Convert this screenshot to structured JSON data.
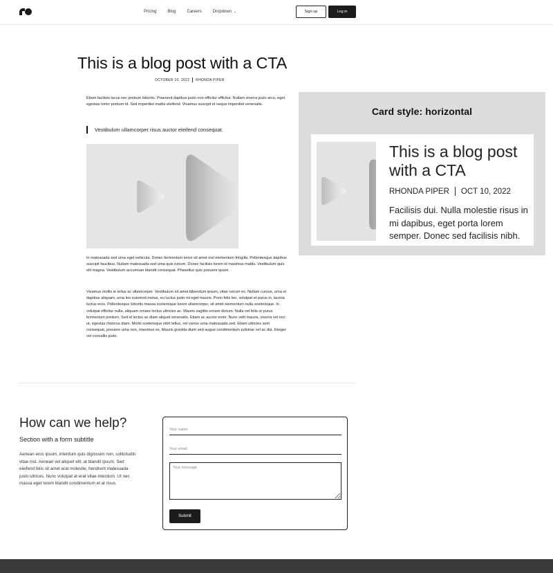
{
  "nav": {
    "links": [
      "Pricing",
      "Blog",
      "Careers",
      "Dropdown"
    ],
    "signup_label": "Sign up",
    "login_label": "Log in"
  },
  "post": {
    "title": "This is a blog post with a CTA",
    "date": "OCTOBER 10, 2022",
    "author": "RHONDA PIPER",
    "paragraph1": "Etiam facilisis lacus nec pretium lobortis. Praesent dapibus justo non efficitur efficitur. Nullam viverra justo arcu, eget egestas tortor pretium id. Sed imperdiet mattis eleifend. Vivamus suscipit et neque imperdiet venenatis.",
    "quote": "Vestibulum ullamcorper risus auctor eleifend consequat.",
    "paragraph2": "In malesuada sed urna eget vehicula. Donec fermentum tortor sit amet nisl elementum fringilla. Pellentesque dapibus suscipit faucibus. Nullam malesuada sed urna quis rutrum. Donec facilisis lorem id maximus mattis. Vestibulum quis elit magna. Vestibulum accumsan blandit consequat. Phasellus quis posuere quam.",
    "paragraph3": "Vivamus mollis in tellus ac ullamcorper. Vestibulum sit amet bibendum ipsum, vitae rutrum ex. Nullam cursus, urna et dapibus aliquam, urna leo euismod metus, eu luctus justo mi eget mauris. Proin felis leo, volutpat et purus in, lacinia luctus eros. Pellentesque lobortis massa scelerisque lorem ullamcorper, sit amet elementum nulla scelerisque. In volutpat efficitur nulla, aliquam ornare lectus ultricies ac. Mauris sagittis ornare dictum. Nulla vel felis ut purus fermentum pretium. Sed id lectus ac diam aliquet venenatis. Etiam ac auctor enim. Nunc velit mauris, viverra vel orci ut, egestas rhoncus diam. Morbi scelerisque nibh tellus, vel varius urna malesuada sed. Etiam ultricies sem consequat, posuere urna non, maximus ex. Mauris gravida diam sed augue condimentum pulvinar vel ac dui. Integer vel convallis justo."
  },
  "card_panel": {
    "heading": "Card style: horizontal",
    "card_title": "This is a blog post with a CTA",
    "card_author": "RHONDA PIPER",
    "card_date": "OCT 10, 2022",
    "card_excerpt": "Facilisis dui. Nulla molestie risus in mi dapibus, eget porta lorem semper. Donec sed facilisis nibh."
  },
  "help": {
    "title": "How can we help?",
    "subtitle": "Section with a form subtitle",
    "body": "Aenean eros ipsum, interdum quis dignissim non, sollicitudin vitae nisl. Aenean vel aliquet elit, at blandit ipsum. Sed eleifend felis sit amet erat molestie, hendrerit malesuada justo ultrices. Nunc volutpat at erat vitae interdum. Ut nec massa eget lorem blandit condimentum et at risus.",
    "name_placeholder": "Your name",
    "email_placeholder": "Your email",
    "message_placeholder": "Your message",
    "submit_label": "Submit"
  },
  "icons": {
    "logo": "brand-logo-icon",
    "chevron": "chevron-down-icon",
    "image": "play-shapes-image"
  }
}
